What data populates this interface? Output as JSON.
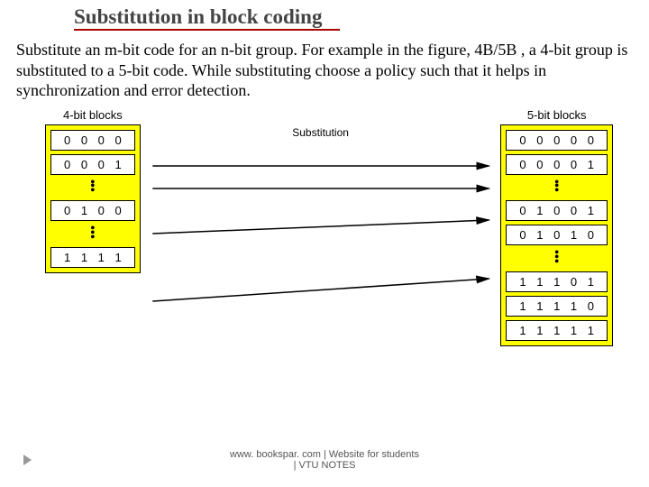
{
  "title": "Substitution in block coding",
  "paragraph": "Substitute an m-bit code for an n-bit group. For example in the figure, 4B/5B , a 4-bit group is substituted to a 5-bit code. While substituting choose a policy such that it helps in synchronization and error detection.",
  "left": {
    "label": "4-bit blocks",
    "cells": [
      "0 0 0 0",
      "0 0 0 1",
      "0 1 0 0",
      "1 1 1 1"
    ]
  },
  "middle": {
    "label": "Substitution"
  },
  "right": {
    "label": "5-bit blocks",
    "cells": [
      "0 0 0 0 0",
      "0 0 0 0 1",
      "0 1 0 0 1",
      "0 1 0 1 0",
      "1 1 1 0 1",
      "1 1 1 1 0",
      "1 1 1 1 1"
    ]
  },
  "footer": {
    "line1": "www. bookspar. com | Website for students",
    "line2": "| VTU NOTES"
  }
}
